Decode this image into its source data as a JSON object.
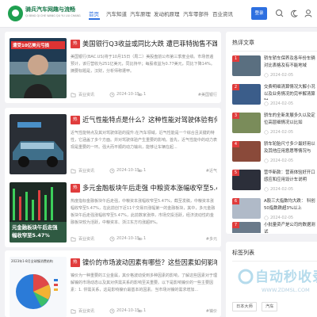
{
  "header": {
    "logo_title": "骑兵汽车网趣与流畅",
    "logo_sub": "QI BING QI CHE WANG QU YU LIU CHANG",
    "nav": [
      "首页",
      "汽车知道",
      "汽车原理",
      "发动机原理",
      "汽车零部件",
      "百业资讯"
    ],
    "active_nav": 0,
    "login_label": "登录"
  },
  "articles": [
    {
      "tag": "热",
      "title": "美国银行Q3收益或同比大跌 遭巴菲特抛售不躁?",
      "summary": "美国银行(BAC.US)将于10月15日（周二）美股盘前公布第三季度业绩。市场普遍预计，该行营收为251亿美元，同比持平；每股收益为0.77美元，同比下降14%。摘要标题是，汉财，分析师称遭甲。",
      "category": "百业资讯",
      "date": "2024-10-15",
      "views": "1",
      "card_tag": "#美国银行",
      "thumb_caption": "遭受10亿美元亏损"
    },
    {
      "tag": "热",
      "title": "近气性能特点是什么？这种性能对驾驶体验有何提升?",
      "summary": "近气性能特点及其对驾驶体验的提升:在汽车领域，近气性能是一个综合且关键的特性，它涵盖了多个方面。并对驾驶体验产生重要的影响。首先，近气性能中的动力表现是重要的一环。强大而平顺的动力输出，能够让车辆在起...",
      "category": "百业资讯",
      "date": "2024-10-15",
      "views": "1",
      "card_tag": "#近气"
    },
    {
      "tag": "热",
      "title": "多元金融板块午后走强 中粮资本涨幅收窄至5.47%",
      "summary": "热度指标金融板块午后走强，中粮资本涨幅收窄至5.47%，截至发稿，中粮资本涨幅收窄至5.47%，在此前创下近11个交易日涨幅第一的金融板块，其中，多元金融板块午后走强涨幅收窄至5.47%，此前数家涨停，市场交投活跃，经济流动性的金融板块较为活跃，中粮资本、浙江东方均涨超8%。",
      "category": "百业资讯",
      "date": "2024-10-15",
      "views": "1",
      "card_tag": "#多元",
      "thumb_caption": "元金融板块午后走强 幅收窄至5.47%"
    },
    {
      "tag": "热",
      "title": "镍价的市场波动因素有哪些？这些因素如何影响市场供需?",
      "summary": "镍价为一种重要的工业金属，其价格波动受到多种因素的影响，了解这些因素对于理解镍的市场动态以及其对供需关系的影响至关重要。以下是影响镍价的一些主要因素：1. 供需关系，这是影响镍价最基本的因素。当市场对镍的需求增加...",
      "category": "百业资讯",
      "date": "2024-10-15",
      "views": "1",
      "card_tag": "#镍价",
      "thumb_caption": "2023年1-8月全球镍消费结构"
    }
  ],
  "sidebar": {
    "title": "热评文章",
    "items": [
      {
        "num": "1",
        "title": "轿车轿车保养及各年份车辆对比表格及有不能地域",
        "date": "2024-02-05"
      },
      {
        "num": "2",
        "title": "交费明细清算情况大解小况以及业务情况的完毕解清算财",
        "date": "2024-02-05"
      },
      {
        "num": "3",
        "title": "骄车的全新发展多久以及定位高层细情况以比如",
        "date": "2024-02-05"
      },
      {
        "num": "4",
        "title": "骄车轮胎尺寸多少最好用以及其他应用意愿等情况与",
        "date": "2024-02-05"
      },
      {
        "num": "5",
        "title": "营华新款：营商体验好开口感应和应用设计车说明",
        "date": "2024-02-05"
      },
      {
        "num": "6",
        "title": "A股三大指数均大跌： 科创50指数跌超3%以上",
        "date": "2024-02-05"
      },
      {
        "num": "7",
        "title": "小批量资产是公司的数据测试",
        "date": "2024-02-05"
      }
    ]
  },
  "tags": {
    "title": "标签列表",
    "items": [
      "日本大师",
      "汽车"
    ]
  },
  "watermark": {
    "main": "自动秒收录",
    "sub": "WWW.ZDMSL.COM"
  },
  "colors": {
    "accent": "#2d6fe0",
    "hot_tag": "#e03c3c",
    "brand_green": "#1fa050"
  },
  "icons": {
    "search": "search-icon",
    "theme": "moon-icon",
    "user": "user-icon"
  }
}
